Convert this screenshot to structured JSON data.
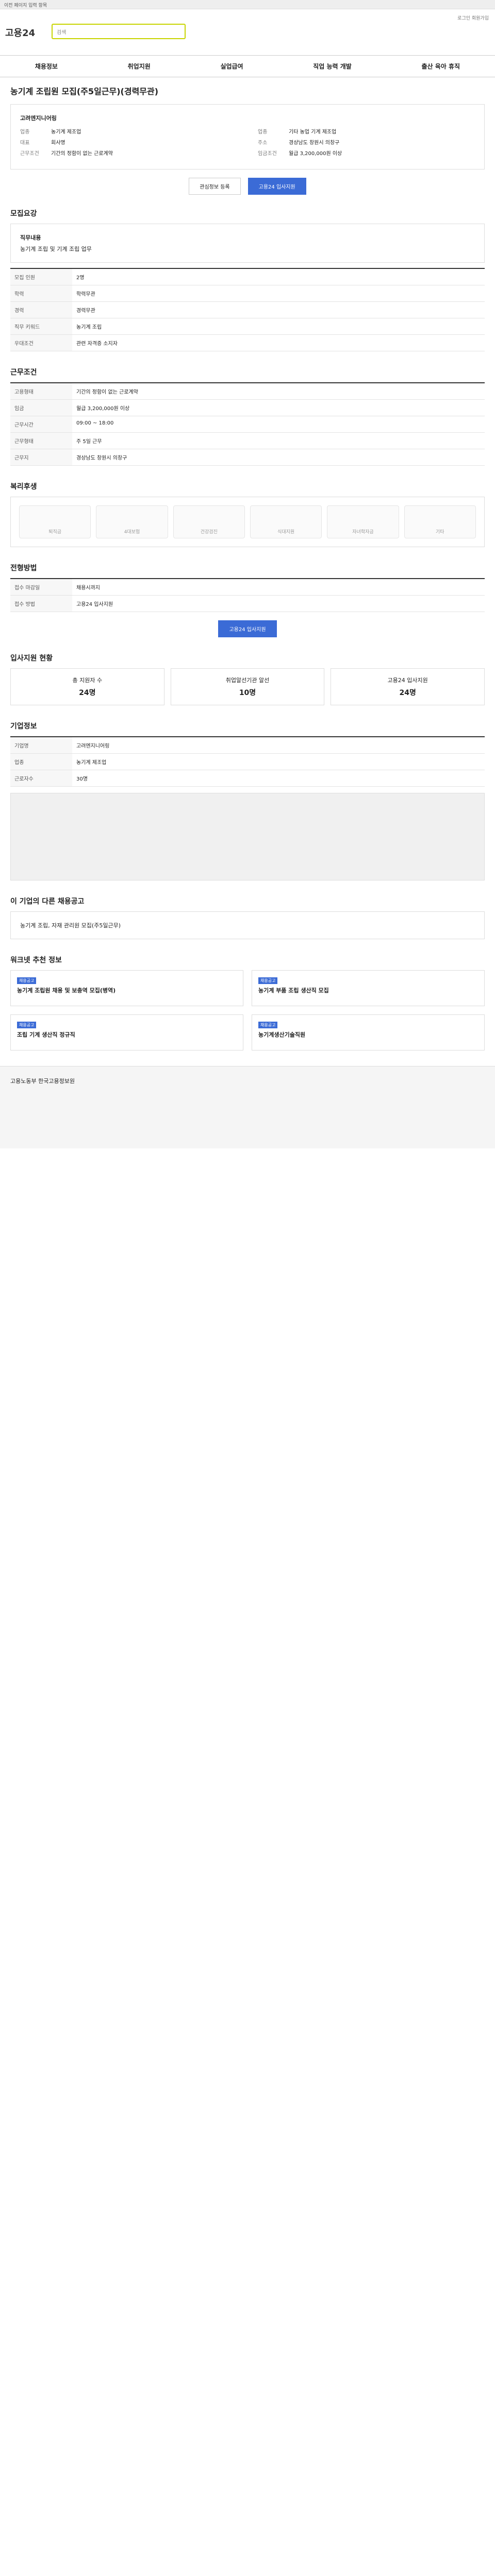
{
  "topbar": {
    "text": "이전 페이지 입력 항목"
  },
  "brand": {
    "logo": "고용24",
    "search_placeholder": "검색"
  },
  "util": {
    "text": "로그인 회원가입"
  },
  "nav": [
    "채용정보",
    "취업지원",
    "실업급여",
    "직업 능력 개발",
    "출산 육아 휴직"
  ],
  "job": {
    "title": "농기계 조립원 모집(주5일근무)(경력무관)",
    "company_label": "기업정보",
    "company_name": "고려엔지니어링",
    "left": [
      {
        "k": "업종",
        "v": "농기계 제조업"
      },
      {
        "k": "대표",
        "v": "회사명"
      }
    ],
    "right": [
      {
        "k": "업종",
        "v": "기타 농업 기계 제조업"
      },
      {
        "k": "주소",
        "v": "경상남도 창원시 의창구"
      }
    ],
    "cond_title": "근무조건",
    "cond": [
      {
        "k": "고용형태",
        "v": "기간의 정함이 없는 근로계약"
      },
      {
        "k": "근무예정지",
        "v": "경상남도 창원시"
      }
    ],
    "wage_title": "임금조건",
    "wage": "월급 3,200,000원 이상",
    "btn_scrap": "관심정보 등록",
    "btn_apply": "고용24 입사지원"
  },
  "recruit": {
    "title": "모집요강",
    "desc_title": "직무내용",
    "desc": "농기계 조립 및 기계 조립 업무",
    "rows": [
      {
        "k": "모집 인원",
        "v": "2명"
      },
      {
        "k": "학력",
        "v": "학력무관"
      },
      {
        "k": "경력",
        "v": "경력무관"
      },
      {
        "k": "직무 키워드",
        "v": "농기계 조립"
      },
      {
        "k": "우대조건",
        "v": "관련 자격증 소지자"
      }
    ]
  },
  "work": {
    "title": "근무조건",
    "rows": [
      {
        "k": "고용형태",
        "v": "기간의 정함이 없는 근로계약"
      },
      {
        "k": "임금",
        "v": "월급 3,200,000원 이상"
      },
      {
        "k": "근무시간",
        "v": "09:00 ~ 18:00"
      },
      {
        "k": "근무형태",
        "v": "주 5일 근무"
      },
      {
        "k": "근무지",
        "v": "경상남도 창원시 의창구"
      }
    ]
  },
  "welfare": {
    "title": "복리후생",
    "items": [
      "퇴직금",
      "4대보험",
      "건강검진",
      "식대지원",
      "자녀학자금",
      "기타"
    ]
  },
  "apply": {
    "title": "전형방법",
    "rows": [
      {
        "k": "접수 마감일",
        "v": "채용시까지"
      },
      {
        "k": "접수 방법",
        "v": "고용24 입사지원"
      }
    ]
  },
  "stats": {
    "title": "입사지원 현황",
    "items": [
      {
        "k": "총 지원자 수",
        "v": "24명"
      },
      {
        "k": "취업알선기관 알선",
        "v": "10명"
      },
      {
        "k": "고용24 입사지원",
        "v": "24명"
      }
    ]
  },
  "company": {
    "title": "기업정보",
    "rows": [
      {
        "k": "기업명",
        "v": "고려엔지니어링"
      },
      {
        "k": "업종",
        "v": "농기계 제조업"
      },
      {
        "k": "근로자수",
        "v": "30명"
      }
    ]
  },
  "related": {
    "title": "이 기업의 다른 채용공고",
    "item": "농기계 조립, 자재 관리원 모집(주5일근무)"
  },
  "recommend": {
    "title": "워크넷 추천 정보",
    "cards": [
      {
        "tag": "채용공고",
        "t": "농기계 조립원 채용 및 보충역 모집(병역)"
      },
      {
        "tag": "채용공고",
        "t": "농기계 부품 조립 생산직 모집"
      },
      {
        "tag": "채용공고",
        "t": "조립 기계 생산직 정규직"
      },
      {
        "tag": "채용공고",
        "t": "농기계생산기술직원"
      }
    ]
  },
  "footer": {
    "text": "고용노동부 한국고용정보원"
  }
}
